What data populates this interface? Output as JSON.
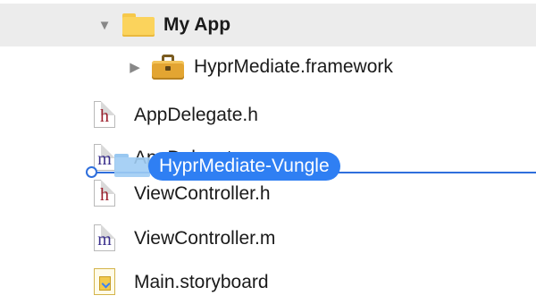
{
  "navigator": {
    "group": {
      "label": "My App",
      "disclosure": "▼",
      "icon": "folder-icon"
    },
    "framework": {
      "label": "HyprMediate.framework",
      "disclosure": "▶",
      "icon": "toolbox-icon"
    },
    "files": [
      {
        "label": "AppDelegate.h",
        "glyph": "h",
        "icon": "header-file-icon"
      },
      {
        "label": "AppDelegate.m",
        "glyph": "m",
        "icon": "implementation-file-icon"
      },
      {
        "label": "ViewController.h",
        "glyph": "h",
        "icon": "header-file-icon"
      },
      {
        "label": "ViewController.m",
        "glyph": "m",
        "icon": "implementation-file-icon"
      },
      {
        "label": "Main.storyboard",
        "glyph": "",
        "icon": "storyboard-file-icon"
      }
    ]
  },
  "drag": {
    "label": "HyprMediate-Vungle",
    "icon": "folder-icon"
  },
  "colors": {
    "accent": "#2f7ff3",
    "group_row_bg": "#ececec",
    "header_glyph": "#9c1f2c",
    "impl_glyph": "#3a2f8c"
  }
}
